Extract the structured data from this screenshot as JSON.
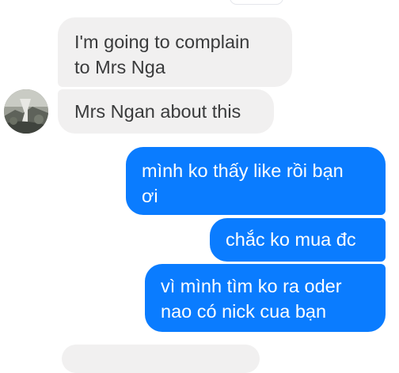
{
  "conversation": {
    "messages": [
      {
        "sender": "contact",
        "text_lines": [
          "I'm going to complain",
          "to Mrs Nga"
        ]
      },
      {
        "sender": "contact",
        "text_lines": [
          "Mrs Ngan about this"
        ]
      },
      {
        "sender": "me",
        "text_lines": [
          "mình ko thấy like rồi bạn",
          "ơi"
        ]
      },
      {
        "sender": "me",
        "text_lines": [
          "chắc ko mua đc"
        ]
      },
      {
        "sender": "me",
        "text_lines": [
          "vì mình tìm ko ra oder",
          "nao có nick cua bạn"
        ]
      }
    ]
  },
  "colors": {
    "incoming_bubble": "#f1f0f0",
    "incoming_text": "#3a3b3c",
    "outgoing_bubble": "#0a7cff",
    "outgoing_text": "#ffffff"
  },
  "icons": {
    "avatar": "contact-avatar-photo"
  }
}
